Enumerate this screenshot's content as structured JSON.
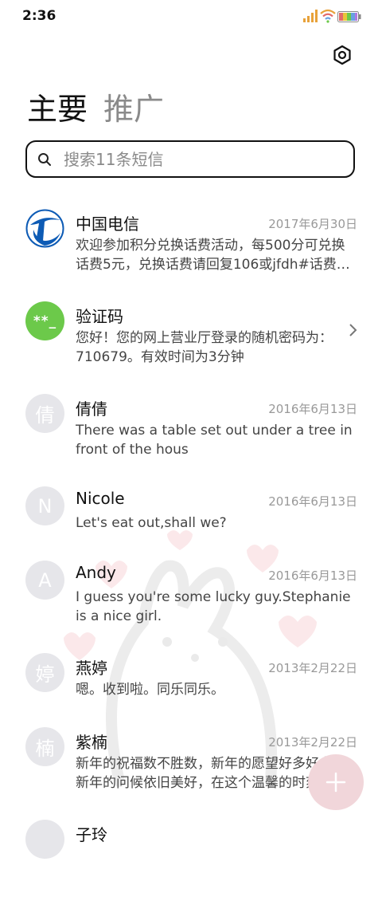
{
  "status_bar": {
    "time": "2:36"
  },
  "tabs": [
    {
      "label": "主要",
      "active": true
    },
    {
      "label": "推广",
      "active": false
    }
  ],
  "search": {
    "placeholder": "搜索11条短信"
  },
  "messages": [
    {
      "name": "中国电信",
      "date": "2017年6月30日",
      "preview": "欢迎参加积分兑换话费活动，每500分可兑换话费5元，兑换话费请回复106或jfdh#话费兑换#积分",
      "avatar": "china-telecom-logo"
    },
    {
      "name": "验证码",
      "date": "",
      "preview": "您好！您的网上营业厅登录的随机密码为：710679。有效时间为3分钟",
      "avatar": "**_"
    },
    {
      "name": "倩倩",
      "date": "2016年6月13日",
      "preview": "There was a table set out under a tree in front of the hous",
      "avatar": "倩"
    },
    {
      "name": "Nicole",
      "date": "2016年6月13日",
      "preview": "Let's eat out,shall we?",
      "avatar": "N"
    },
    {
      "name": "Andy",
      "date": "2016年6月13日",
      "preview": "I guess you're some lucky guy.Stephanie is a nice girl.",
      "avatar": "A"
    },
    {
      "name": "燕婷",
      "date": "2013年2月22日",
      "preview": "嗯。收到啦。同乐同乐。",
      "avatar": "婷"
    },
    {
      "name": "紫楠",
      "date": "2013年2月22日",
      "preview": "新年的祝福数不胜数，新年的愿望好多好多，新年的问候依旧美好，在这个温馨的时刻",
      "avatar": "楠"
    },
    {
      "name": "子玲",
      "date": "",
      "preview": "",
      "avatar": ""
    }
  ],
  "colors": {
    "accent_green": "#6cc94a",
    "telecom_blue": "#0d5bb5",
    "fab_pink": "#f1d6da"
  },
  "icons": {
    "settings": "settings-hexagon-icon",
    "search": "search-icon",
    "fab": "plus-icon"
  }
}
